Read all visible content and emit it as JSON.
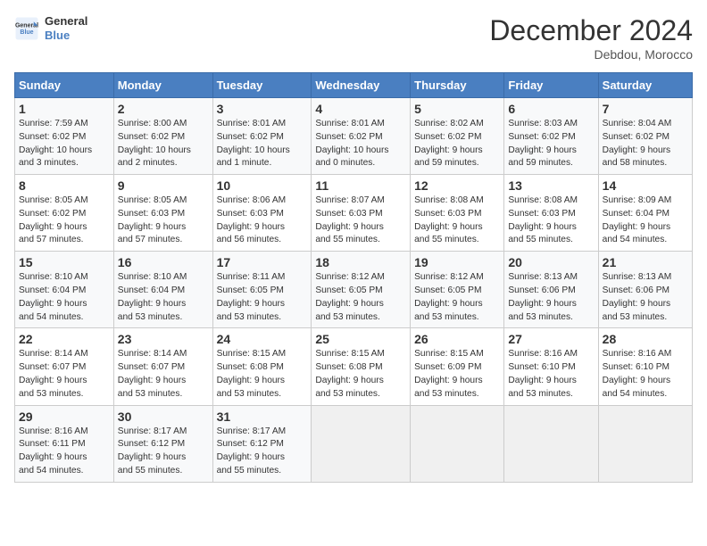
{
  "header": {
    "logo_line1": "General",
    "logo_line2": "Blue",
    "month_title": "December 2024",
    "subtitle": "Debdou, Morocco"
  },
  "weekdays": [
    "Sunday",
    "Monday",
    "Tuesday",
    "Wednesday",
    "Thursday",
    "Friday",
    "Saturday"
  ],
  "weeks": [
    [
      {
        "num": "1",
        "info": "Sunrise: 7:59 AM\nSunset: 6:02 PM\nDaylight: 10 hours\nand 3 minutes."
      },
      {
        "num": "2",
        "info": "Sunrise: 8:00 AM\nSunset: 6:02 PM\nDaylight: 10 hours\nand 2 minutes."
      },
      {
        "num": "3",
        "info": "Sunrise: 8:01 AM\nSunset: 6:02 PM\nDaylight: 10 hours\nand 1 minute."
      },
      {
        "num": "4",
        "info": "Sunrise: 8:01 AM\nSunset: 6:02 PM\nDaylight: 10 hours\nand 0 minutes."
      },
      {
        "num": "5",
        "info": "Sunrise: 8:02 AM\nSunset: 6:02 PM\nDaylight: 9 hours\nand 59 minutes."
      },
      {
        "num": "6",
        "info": "Sunrise: 8:03 AM\nSunset: 6:02 PM\nDaylight: 9 hours\nand 59 minutes."
      },
      {
        "num": "7",
        "info": "Sunrise: 8:04 AM\nSunset: 6:02 PM\nDaylight: 9 hours\nand 58 minutes."
      }
    ],
    [
      {
        "num": "8",
        "info": "Sunrise: 8:05 AM\nSunset: 6:02 PM\nDaylight: 9 hours\nand 57 minutes."
      },
      {
        "num": "9",
        "info": "Sunrise: 8:05 AM\nSunset: 6:03 PM\nDaylight: 9 hours\nand 57 minutes."
      },
      {
        "num": "10",
        "info": "Sunrise: 8:06 AM\nSunset: 6:03 PM\nDaylight: 9 hours\nand 56 minutes."
      },
      {
        "num": "11",
        "info": "Sunrise: 8:07 AM\nSunset: 6:03 PM\nDaylight: 9 hours\nand 55 minutes."
      },
      {
        "num": "12",
        "info": "Sunrise: 8:08 AM\nSunset: 6:03 PM\nDaylight: 9 hours\nand 55 minutes."
      },
      {
        "num": "13",
        "info": "Sunrise: 8:08 AM\nSunset: 6:03 PM\nDaylight: 9 hours\nand 55 minutes."
      },
      {
        "num": "14",
        "info": "Sunrise: 8:09 AM\nSunset: 6:04 PM\nDaylight: 9 hours\nand 54 minutes."
      }
    ],
    [
      {
        "num": "15",
        "info": "Sunrise: 8:10 AM\nSunset: 6:04 PM\nDaylight: 9 hours\nand 54 minutes."
      },
      {
        "num": "16",
        "info": "Sunrise: 8:10 AM\nSunset: 6:04 PM\nDaylight: 9 hours\nand 53 minutes."
      },
      {
        "num": "17",
        "info": "Sunrise: 8:11 AM\nSunset: 6:05 PM\nDaylight: 9 hours\nand 53 minutes."
      },
      {
        "num": "18",
        "info": "Sunrise: 8:12 AM\nSunset: 6:05 PM\nDaylight: 9 hours\nand 53 minutes."
      },
      {
        "num": "19",
        "info": "Sunrise: 8:12 AM\nSunset: 6:05 PM\nDaylight: 9 hours\nand 53 minutes."
      },
      {
        "num": "20",
        "info": "Sunrise: 8:13 AM\nSunset: 6:06 PM\nDaylight: 9 hours\nand 53 minutes."
      },
      {
        "num": "21",
        "info": "Sunrise: 8:13 AM\nSunset: 6:06 PM\nDaylight: 9 hours\nand 53 minutes."
      }
    ],
    [
      {
        "num": "22",
        "info": "Sunrise: 8:14 AM\nSunset: 6:07 PM\nDaylight: 9 hours\nand 53 minutes."
      },
      {
        "num": "23",
        "info": "Sunrise: 8:14 AM\nSunset: 6:07 PM\nDaylight: 9 hours\nand 53 minutes."
      },
      {
        "num": "24",
        "info": "Sunrise: 8:15 AM\nSunset: 6:08 PM\nDaylight: 9 hours\nand 53 minutes."
      },
      {
        "num": "25",
        "info": "Sunrise: 8:15 AM\nSunset: 6:08 PM\nDaylight: 9 hours\nand 53 minutes."
      },
      {
        "num": "26",
        "info": "Sunrise: 8:15 AM\nSunset: 6:09 PM\nDaylight: 9 hours\nand 53 minutes."
      },
      {
        "num": "27",
        "info": "Sunrise: 8:16 AM\nSunset: 6:10 PM\nDaylight: 9 hours\nand 53 minutes."
      },
      {
        "num": "28",
        "info": "Sunrise: 8:16 AM\nSunset: 6:10 PM\nDaylight: 9 hours\nand 54 minutes."
      }
    ],
    [
      {
        "num": "29",
        "info": "Sunrise: 8:16 AM\nSunset: 6:11 PM\nDaylight: 9 hours\nand 54 minutes."
      },
      {
        "num": "30",
        "info": "Sunrise: 8:17 AM\nSunset: 6:12 PM\nDaylight: 9 hours\nand 55 minutes."
      },
      {
        "num": "31",
        "info": "Sunrise: 8:17 AM\nSunset: 6:12 PM\nDaylight: 9 hours\nand 55 minutes."
      },
      null,
      null,
      null,
      null
    ]
  ]
}
